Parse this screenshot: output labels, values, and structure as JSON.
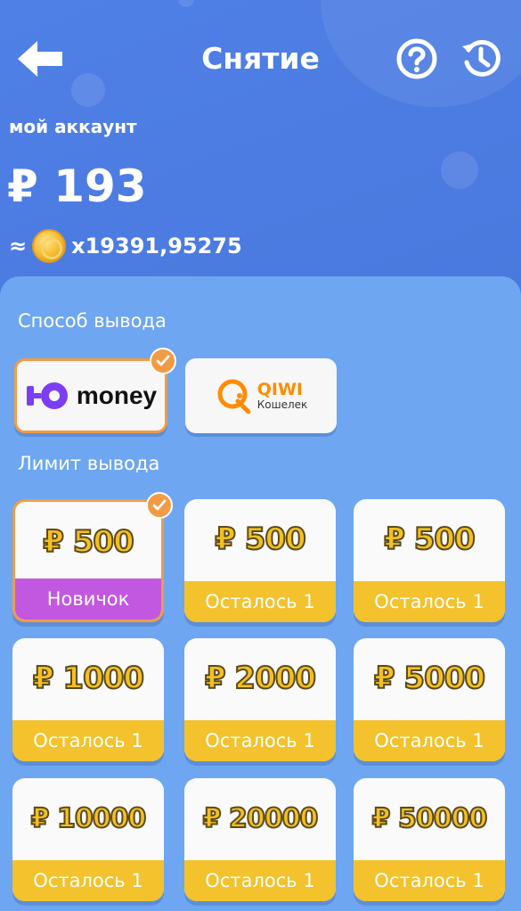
{
  "header": {
    "title": "Снятие",
    "back_icon": "arrow-left-icon",
    "help_icon": "question-circle-icon",
    "history_icon": "history-clock-icon"
  },
  "account": {
    "label": "мой аккаунт",
    "balance": "₽ 193",
    "approx_sign": "≈",
    "coins": "x19391,95275"
  },
  "withdraw_method": {
    "label": "Способ вывода",
    "options": [
      {
        "name": "money",
        "logo_mark": "Ю",
        "selected": true
      },
      {
        "name": "QIWI",
        "subtitle": "Кошелек",
        "selected": false
      }
    ]
  },
  "withdraw_limit": {
    "label": "Лимит вывода",
    "tiles": [
      {
        "amount": "₽ 500",
        "footer": "Новичок",
        "selected": true
      },
      {
        "amount": "₽ 500",
        "footer": "Осталось 1",
        "selected": false
      },
      {
        "amount": "₽ 500",
        "footer": "Осталось 1",
        "selected": false
      },
      {
        "amount": "₽ 1000",
        "footer": "Осталось 1",
        "selected": false
      },
      {
        "amount": "₽ 2000",
        "footer": "Осталось 1",
        "selected": false
      },
      {
        "amount": "₽ 5000",
        "footer": "Осталось 1",
        "selected": false
      },
      {
        "amount": "₽ 10000",
        "footer": "Осталось 1",
        "selected": false
      },
      {
        "amount": "₽ 20000",
        "footer": "Осталось 1",
        "selected": false
      },
      {
        "amount": "₽ 50000",
        "footer": "Осталось 1",
        "selected": false
      }
    ]
  },
  "colors": {
    "header_bg": "#4d7ee2",
    "panel_bg": "#6ea6f1",
    "accent_orange": "#f29b45",
    "gold": "#f3c22c",
    "novice_purple": "#c258e0",
    "yoomoney_purple": "#7b3ef2",
    "qiwi_orange": "#ff8c00"
  }
}
